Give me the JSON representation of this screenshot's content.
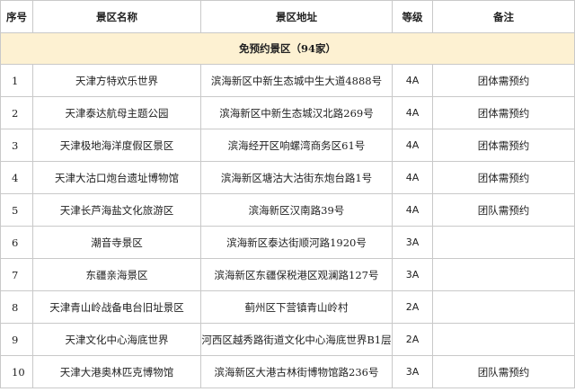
{
  "table": {
    "headers": [
      "序号",
      "景区名称",
      "景区地址",
      "等级",
      "备注"
    ],
    "section_title": "免预约景区（94家）",
    "rows": [
      {
        "no": "1",
        "name": "天津方特欢乐世界",
        "address": "滨海新区中新生态城中生大道4888号",
        "level": "4A",
        "note": "团体需预约"
      },
      {
        "no": "2",
        "name": "天津泰达航母主题公园",
        "address": "滨海新区中新生态城汉北路269号",
        "level": "4A",
        "note": "团体需预约"
      },
      {
        "no": "3",
        "name": "天津极地海洋度假区景区",
        "address": "滨海经开区响螺湾商务区61号",
        "level": "4A",
        "note": "团体需预约"
      },
      {
        "no": "4",
        "name": "天津大沽口炮台遗址博物馆",
        "address": "滨海新区塘沽大沽街东炮台路1号",
        "level": "4A",
        "note": "团体需预约"
      },
      {
        "no": "5",
        "name": "天津长芦海盐文化旅游区",
        "address": "滨海新区汉南路39号",
        "level": "4A",
        "note": "团队需预约"
      },
      {
        "no": "6",
        "name": "潮音寺景区",
        "address": "滨海新区泰达街顺河路1920号",
        "level": "3A",
        "note": ""
      },
      {
        "no": "7",
        "name": "东疆亲海景区",
        "address": "滨海新区东疆保税港区观澜路127号",
        "level": "3A",
        "note": ""
      },
      {
        "no": "8",
        "name": "天津青山岭战备电台旧址景区",
        "address": "蓟州区下营镇青山岭村",
        "level": "2A",
        "note": ""
      },
      {
        "no": "9",
        "name": "天津文化中心海底世界",
        "address": "河西区越秀路街道文化中心海底世界B1层",
        "level": "2A",
        "note": ""
      },
      {
        "no": "10",
        "name": "天津大港奥林匹克博物馆",
        "address": "滨海新区大港古林街博物馆路236号",
        "level": "3A",
        "note": "团队需预约"
      }
    ]
  }
}
